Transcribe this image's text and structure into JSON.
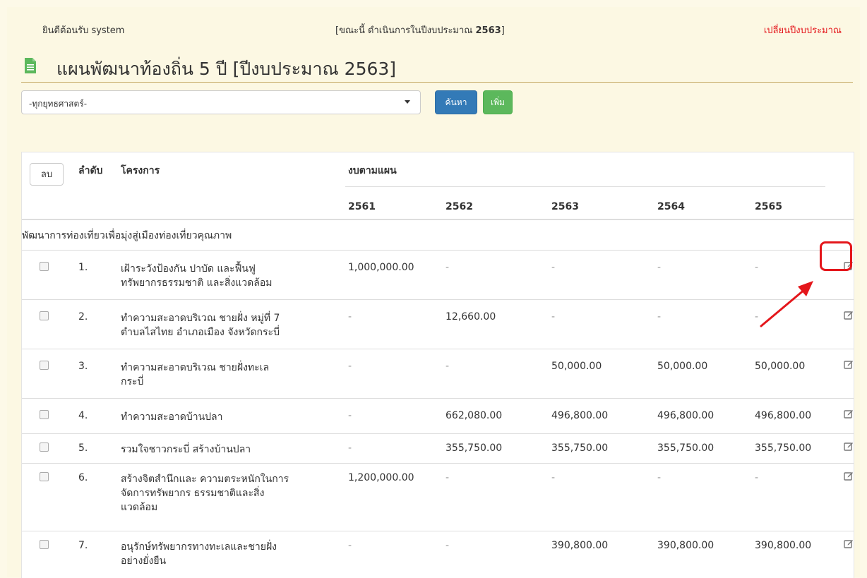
{
  "topbar": {
    "welcome": "ยินดีต้อนรับ system",
    "status_prefix": "[ขณะนี้ ดำเนินการในปีงบประมาณ ",
    "status_year": "2563",
    "status_suffix": "]",
    "change_year_link": "เปลี่ยนปีงบประมาณ"
  },
  "page": {
    "title": "แผนพัฒนาท้องถิ่น 5 ปี [ปีงบประมาณ 2563]"
  },
  "filter": {
    "strategy_selected": "-ทุกยุทธศาสตร์-",
    "search_label": "ค้นหา",
    "add_label": "เพิ่ม"
  },
  "table": {
    "delete_label": "ลบ",
    "col_order": "ลำดับ",
    "col_project": "โครงการ",
    "col_budget": "งบตามแผน",
    "years": [
      "2561",
      "2562",
      "2563",
      "2564",
      "2565"
    ],
    "group_label": "พัฒนาการท่องเที่ยวเพื่อมุ่งสู่เมืองท่องเที่ยวคุณภาพ",
    "rows": [
      {
        "num": "1.",
        "project_lines": [
          "เฝ้าระวังป้องกัน ปาบัด และฟื้นฟู",
          "ทรัพยากรธรรมชาติ และสิ่งแวดล้อม"
        ],
        "budgets": [
          "1,000,000.00",
          "-",
          "-",
          "-",
          "-"
        ]
      },
      {
        "num": "2.",
        "project_lines": [
          "ทำความสะอาดบริเวณ ชายฝั่ง หมู่ที่ 7",
          "ตำบลไสไทย อำเภอเมือง จังหวัดกระบี่"
        ],
        "budgets": [
          "-",
          "12,660.00",
          "-",
          "-",
          "-"
        ]
      },
      {
        "num": "3.",
        "project_lines": [
          "ทำความสะอาดบริเวณ ชายฝั่งทะเล",
          "กระบี่"
        ],
        "budgets": [
          "-",
          "-",
          "50,000.00",
          "50,000.00",
          "50,000.00"
        ]
      },
      {
        "num": "4.",
        "project_lines": [
          "ทำความสะอาดบ้านปลา"
        ],
        "budgets": [
          "-",
          "662,080.00",
          "496,800.00",
          "496,800.00",
          "496,800.00"
        ]
      },
      {
        "num": "5.",
        "project_lines": [
          "รวมใจชาวกระบี่ สร้างบ้านปลา"
        ],
        "budgets": [
          "-",
          "355,750.00",
          "355,750.00",
          "355,750.00",
          "355,750.00"
        ]
      },
      {
        "num": "6.",
        "project_lines": [
          "สร้างจิตสำนึกและ ความตระหนักในการ",
          "จัดการทรัพยากร ธรรมชาติและสิ่ง",
          "แวดล้อม"
        ],
        "budgets": [
          "1,200,000.00",
          "-",
          "-",
          "-",
          "-"
        ]
      },
      {
        "num": "7.",
        "project_lines": [
          "อนุรักษ์ทรัพยากรทางทะเลและชายฝั่ง",
          "อย่างยั่งยืน"
        ],
        "budgets": [
          "-",
          "-",
          "390,800.00",
          "390,800.00",
          "390,800.00"
        ]
      }
    ]
  },
  "icons": {
    "doc": "document-icon",
    "edit": "edit-icon",
    "caret": "chevron-down-icon"
  },
  "colors": {
    "background": "#fcf8e3",
    "link_red": "#e4161b",
    "primary": "#337ab7",
    "success": "#5cb85c",
    "doc_green": "#5cb85c"
  }
}
